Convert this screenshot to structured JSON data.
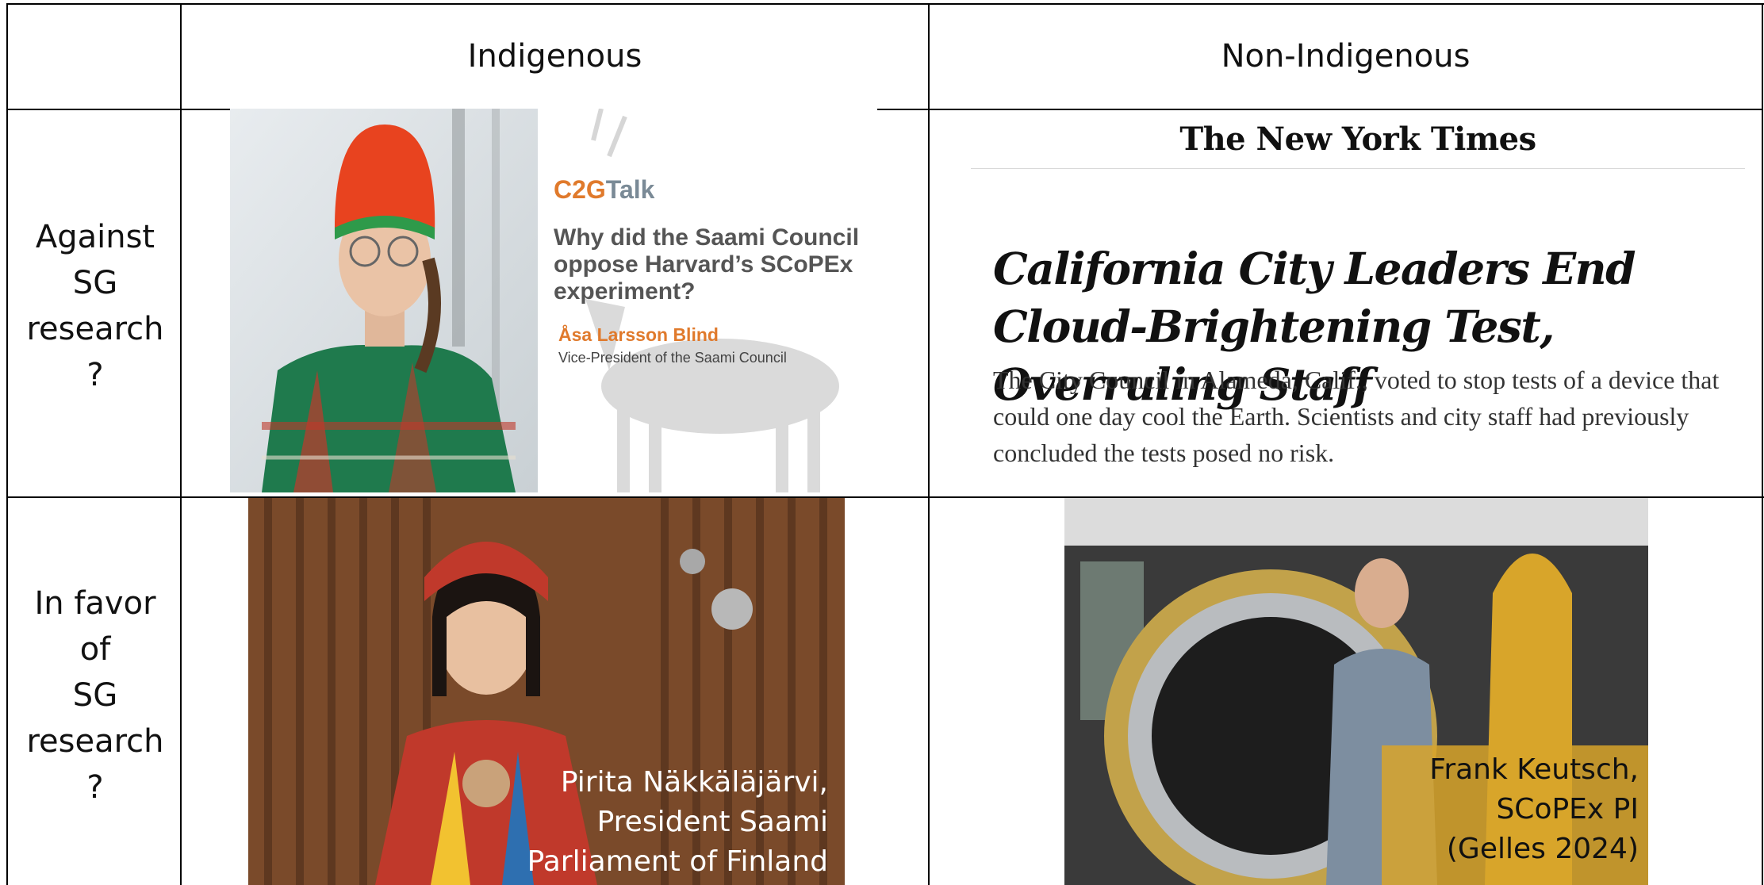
{
  "table": {
    "headers": {
      "col1": "Indigenous",
      "col2": "Non-Indigenous"
    },
    "rows": [
      {
        "label": [
          "Against",
          "SG",
          "research",
          "?"
        ]
      },
      {
        "label": [
          "In favor",
          "of",
          "SG",
          "research",
          "?"
        ]
      }
    ]
  },
  "c2g_card": {
    "brand_a": "C2G",
    "brand_b": "Talk",
    "question": "Why did the Saami Council oppose Harvard’s SCoPEx experiment?",
    "speaker": "Åsa Larsson Blind",
    "role": "Vice-President of the Saami Council"
  },
  "nyt_article": {
    "masthead": "The New York Times",
    "headline": "California City Leaders End Cloud-Brightening Test, Overruling Staff",
    "summary": "The City Council in Alameda, Calif., voted to stop tests of a device that could one day cool the Earth. Scientists and city staff had previously concluded the tests posed no risk."
  },
  "captions": {
    "pirita": [
      "Pirita Näkkäläjärvi,",
      "President Saami",
      "Parliament of Finland"
    ],
    "frank": [
      "Frank Keutsch,",
      "SCoPEx PI",
      "(Gelles 2024)"
    ]
  }
}
